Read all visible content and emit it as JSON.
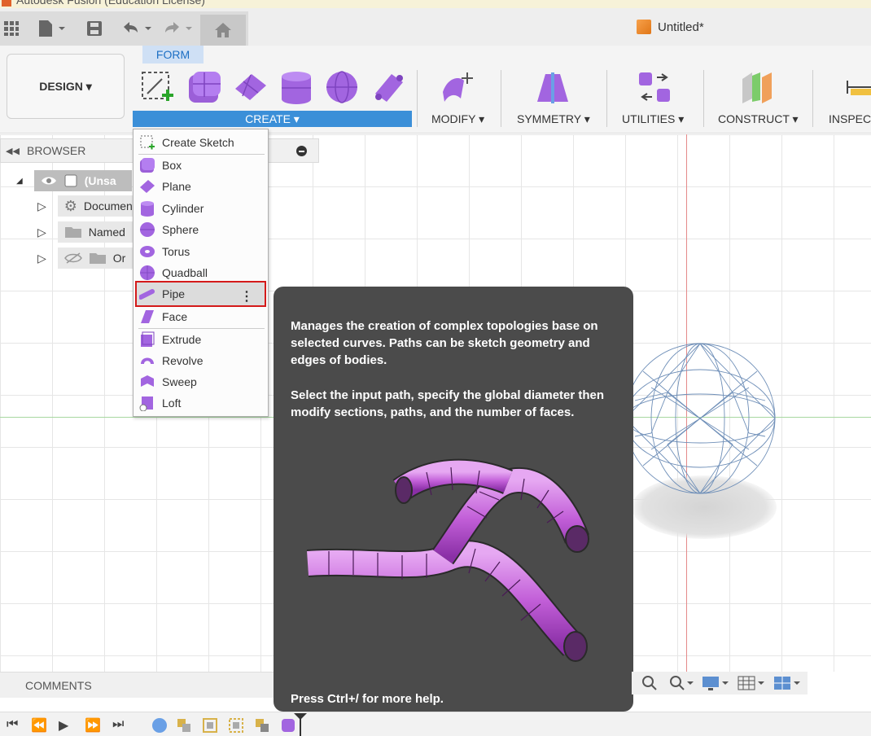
{
  "window": {
    "title": "Autodesk Fusion (Education License)"
  },
  "document": {
    "title": "Untitled*"
  },
  "workspace": {
    "design_label": "DESIGN ▾",
    "active_tab": "FORM"
  },
  "ribbon": {
    "create_label": "CREATE ▾",
    "groups": {
      "modify": "MODIFY ▾",
      "symmetry": "SYMMETRY ▾",
      "utilities": "UTILITIES ▾",
      "construct": "CONSTRUCT ▾",
      "inspect": "INSPEC"
    }
  },
  "browser": {
    "title": "BROWSER",
    "items": [
      {
        "label": "(Unsa"
      },
      {
        "label": "Documen"
      },
      {
        "label": "Named"
      },
      {
        "label": "Or"
      }
    ]
  },
  "menu": {
    "items": [
      {
        "label": "Create Sketch"
      },
      {
        "label": "Box"
      },
      {
        "label": "Plane"
      },
      {
        "label": "Cylinder"
      },
      {
        "label": "Sphere"
      },
      {
        "label": "Torus"
      },
      {
        "label": "Quadball"
      },
      {
        "label": "Pipe"
      },
      {
        "label": "Face"
      },
      {
        "label": "Extrude"
      },
      {
        "label": "Revolve"
      },
      {
        "label": "Sweep"
      },
      {
        "label": "Loft"
      }
    ],
    "highlighted": "Pipe"
  },
  "tooltip": {
    "description": "Manages the creation of complex topologies base on selected curves. Paths can be sketch geometry and edges of bodies.",
    "instructions": "Select the input path, specify the global diameter then modify sections, paths, and the number of faces.",
    "help": "Press Ctrl+/ for more help."
  },
  "comments": {
    "label": "COMMENTS"
  },
  "colors": {
    "accent": "#3b8fd8",
    "form_purple": "#a265e0",
    "highlight": "#d41a1a"
  }
}
